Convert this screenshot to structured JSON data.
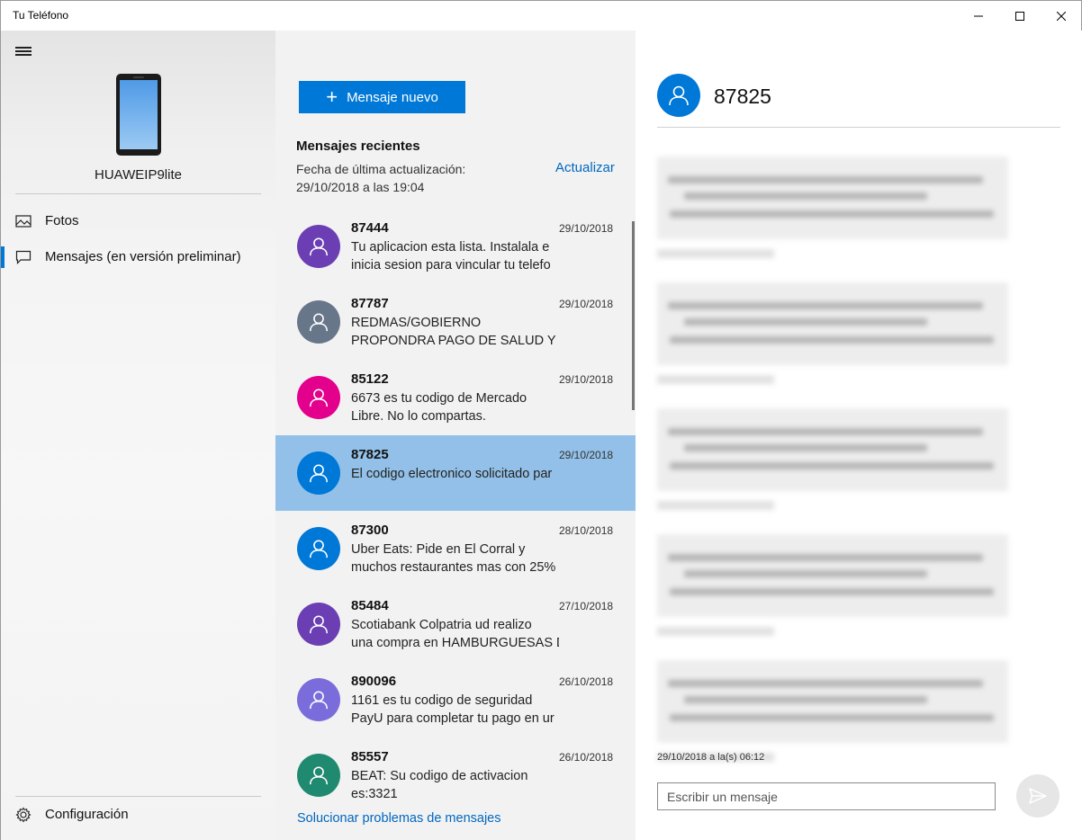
{
  "window": {
    "title": "Tu Teléfono"
  },
  "sidebar": {
    "device_name": "HUAWEIP9lite",
    "items": [
      {
        "label": "Fotos",
        "icon": "photos-icon"
      },
      {
        "label": "Mensajes (en versión preliminar)",
        "icon": "chat-icon",
        "selected": true
      }
    ],
    "settings_label": "Configuración"
  },
  "messages": {
    "new_button_label": "Mensaje nuevo",
    "recent_title": "Mensajes recientes",
    "updated_line1": "Fecha de última actualización:",
    "updated_line2": "29/10/2018 a las 19:04",
    "refresh_label": "Actualizar",
    "troubleshoot_label": "Solucionar problemas de mensajes",
    "items": [
      {
        "sender": "87444",
        "date": "29/10/2018",
        "line1": "Tu aplicacion esta lista. Instalala e",
        "line2": "inicia sesion para vincular tu telefo",
        "color": "#6b3fb3"
      },
      {
        "sender": "87787",
        "date": "29/10/2018",
        "line1": "REDMAS/GOBIERNO",
        "line2": "PROPONDRA PAGO DE SALUD Y P",
        "color": "#68768a"
      },
      {
        "sender": "85122",
        "date": "29/10/2018",
        "line1": "6673 es tu codigo de Mercado",
        "line2": "Libre. No lo compartas.",
        "color": "#e3008c"
      },
      {
        "sender": "87825",
        "date": "29/10/2018",
        "line1": "",
        "line2": "El codigo electronico solicitado par",
        "color": "#0078d7",
        "selected": true
      },
      {
        "sender": "87300",
        "date": "28/10/2018",
        "line1": "Uber Eats: Pide en El Corral y",
        "line2": "muchos restaurantes mas con 25%",
        "color": "#0078d7"
      },
      {
        "sender": "85484",
        "date": "27/10/2018",
        "line1": "Scotiabank Colpatria ud realizo",
        "line2": "una compra en HAMBURGUESAS D",
        "color": "#6b3fb3"
      },
      {
        "sender": "890096",
        "date": "26/10/2018",
        "line1": "1161 es tu codigo de seguridad",
        "line2": "PayU para completar tu pago en ur",
        "color": "#7a6ddb"
      },
      {
        "sender": "85557",
        "date": "26/10/2018",
        "line1": "BEAT: Su codigo de activacion",
        "line2": "es:3321",
        "color": "#1f8a70"
      }
    ]
  },
  "conversation": {
    "contact": "87825",
    "timestamp": "29/10/2018 a la(s) 06:12",
    "compose_placeholder": "Escribir un mensaje"
  }
}
